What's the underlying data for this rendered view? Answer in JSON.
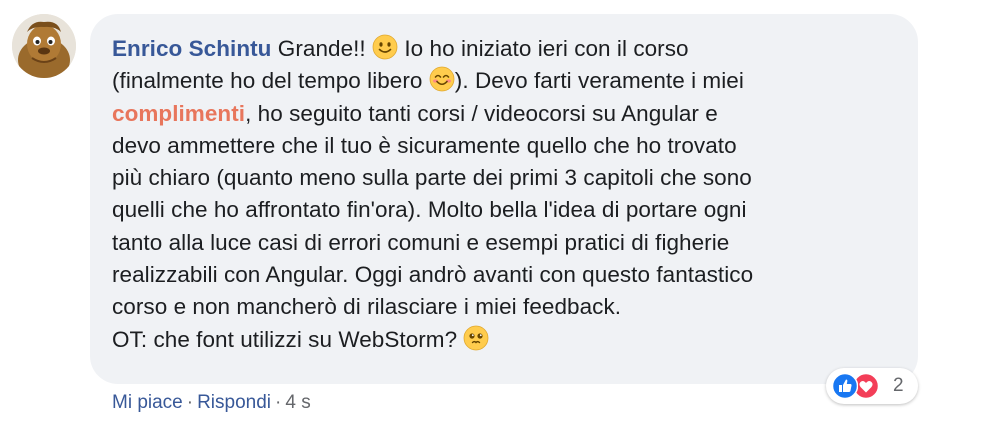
{
  "comment": {
    "author": "Enrico Schintu",
    "text_1": "Grande!!",
    "text_2": "Io ho iniziato ieri con il corso",
    "line_2a": "(finalmente ho del tempo libero",
    "line_2b": "). Devo farti veramente i miei",
    "highlight": "complimenti",
    "line_3b": ", ho seguito tanti corsi / videocorsi su Angular e",
    "line_4": "devo ammettere che il tuo è sicuramente quello che ho trovato",
    "line_5": "più chiaro (quanto meno sulla parte dei primi 3 capitoli che sono",
    "line_6": "quelli che ho affrontato fin'ora). Molto bella l'idea di portare ogni",
    "line_7": "tanto alla luce casi di errori comuni e esempi pratici di figherie",
    "line_8": "realizzabili con Angular. Oggi andrò avanti con questo fantastico",
    "line_9": "corso e non mancherò di rilasciare i miei feedback.",
    "ot_text": "OT: che font utilizzi su WebStorm?"
  },
  "actions": {
    "like": "Mi piace",
    "separator": "·",
    "reply": "Rispondi",
    "time": "4 s"
  },
  "reactions": {
    "types": [
      "like-icon",
      "love-icon"
    ],
    "count": "2"
  },
  "colors": {
    "author": "#385898",
    "highlight": "#e8765c",
    "bubble": "#f0f2f5",
    "like_blue": "#1877f2",
    "love_red": "#f33e58"
  }
}
